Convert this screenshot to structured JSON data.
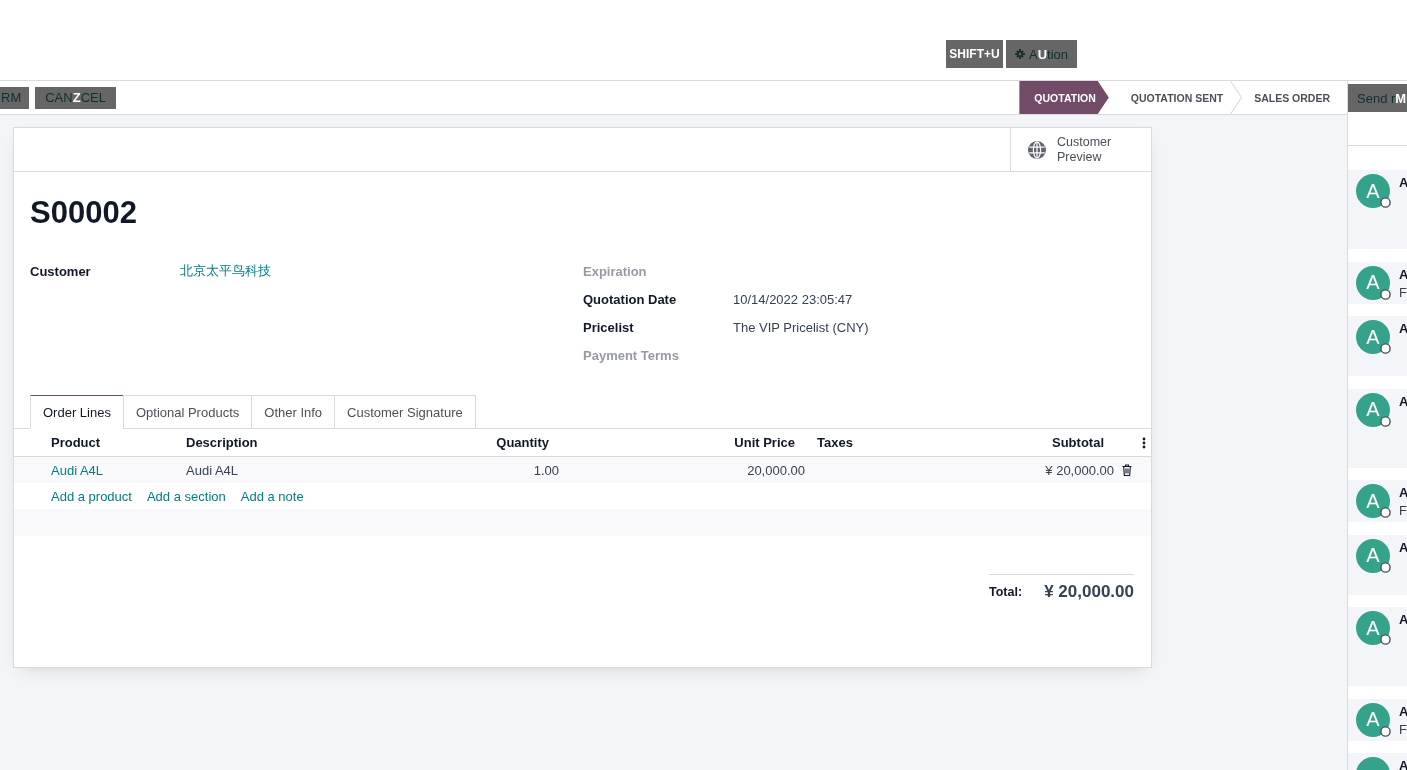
{
  "top_bar": {
    "hotkey_hint": "SHIFT+U",
    "action_button": {
      "label": "A",
      "hotkey": "U",
      "label_end": "tion"
    }
  },
  "control_panel": {
    "buttons": [
      {
        "label": "RM"
      },
      {
        "label": "CAN",
        "hotkey": "Z",
        "label_end": "CEL"
      }
    ],
    "statusbar": [
      {
        "label": "QUOTATION",
        "selected": true
      },
      {
        "label": "QUOTATION SENT",
        "selected": false
      },
      {
        "label": "SALES ORDER",
        "selected": false
      }
    ]
  },
  "sheet": {
    "stat_buttons": [
      {
        "label": "Customer Preview"
      }
    ],
    "title": "S00002",
    "fields_left": [
      {
        "label": "Customer",
        "value": "北京太平鸟科技",
        "kind": "link"
      }
    ],
    "fields_right": [
      {
        "label": "Expiration"
      },
      {
        "label": "Quotation Date",
        "value": "10/14/2022 23:05:47",
        "kind": "text"
      },
      {
        "label": "Pricelist",
        "value": "The VIP Pricelist (CNY)",
        "kind": "text"
      },
      {
        "label": "Payment Terms"
      }
    ],
    "tabs": [
      {
        "label": "Order Lines",
        "selected": true
      },
      {
        "label": "Optional Products",
        "selected": false
      },
      {
        "label": "Other Info",
        "selected": false
      },
      {
        "label": "Customer Signature",
        "selected": false
      }
    ],
    "table": {
      "columns": [
        "Product",
        "Description",
        "Quantity",
        "Unit Price",
        "Taxes",
        "Subtotal"
      ],
      "rows": [
        {
          "product": "Audi A4L",
          "description": "Audi A4L",
          "quantity": "1.00",
          "unit_price": "20,000.00",
          "subtotal": "¥ 20,000.00"
        }
      ],
      "add_links": [
        "Add a product",
        "Add a section",
        "Add a note"
      ]
    },
    "total": {
      "label": "Total:",
      "amount": "¥ 20,000.00"
    }
  },
  "chatter": {
    "send_button": {
      "label": "Send r",
      "hotkey": "M"
    },
    "messages": [
      {
        "avatar_letter": "A",
        "author": "A"
      },
      {
        "avatar_letter": "A",
        "author": "A",
        "body": "F"
      },
      {
        "avatar_letter": "A",
        "author": "A"
      },
      {
        "avatar_letter": "A",
        "author": "A"
      },
      {
        "avatar_letter": "A",
        "author": "A",
        "body": "F"
      },
      {
        "avatar_letter": "A",
        "author": "A"
      },
      {
        "avatar_letter": "A",
        "author": "A"
      },
      {
        "avatar_letter": "A",
        "author": "A",
        "body": "F"
      },
      {
        "author": "A"
      }
    ]
  }
}
